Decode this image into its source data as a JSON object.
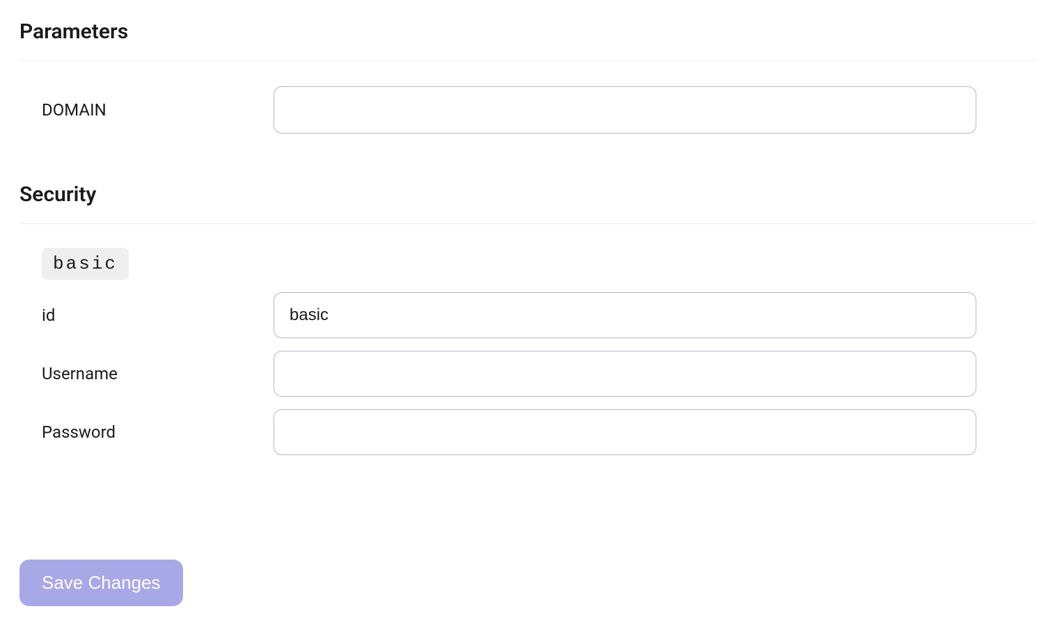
{
  "parameters": {
    "heading": "Parameters",
    "domain": {
      "label": "DOMAIN",
      "value": ""
    }
  },
  "security": {
    "heading": "Security",
    "scheme_pill": "basic",
    "id": {
      "label": "id",
      "value": "basic"
    },
    "username": {
      "label": "Username",
      "value": ""
    },
    "password": {
      "label": "Password",
      "value": ""
    }
  },
  "actions": {
    "save_label": "Save Changes"
  }
}
